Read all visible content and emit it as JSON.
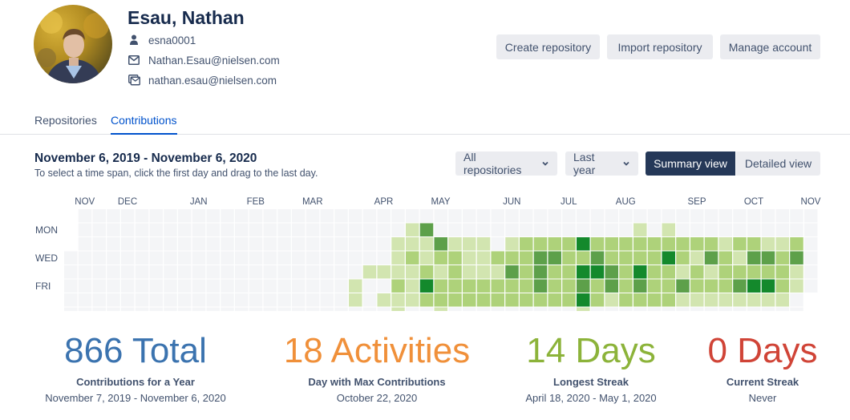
{
  "user": {
    "name": "Esau, Nathan",
    "username": "esna0001",
    "email_primary": "Nathan.Esau@nielsen.com",
    "email_secondary": "nathan.esau@nielsen.com"
  },
  "actions": {
    "create": "Create repository",
    "import": "Import repository",
    "manage": "Manage account"
  },
  "tabs": {
    "repositories": "Repositories",
    "contributions": "Contributions",
    "active": "Contributions"
  },
  "range": {
    "title": "November 6, 2019 - November 6, 2020",
    "hint": "To select a time span, click the first day and drag to the last day."
  },
  "filters": {
    "repos": "All repositories",
    "timespan": "Last year",
    "summary_view": "Summary view",
    "detailed_view": "Detailed view",
    "active_view": "Summary view"
  },
  "colors": {
    "accent": "#0052cc",
    "dark_button": "#253858",
    "total": "#3b73af",
    "activities": "#f0903a",
    "longest": "#8cb33a",
    "current": "#d04437",
    "level_0": "#f4f5f7",
    "level_1": "#d2e5b0",
    "level_2": "#aed27a",
    "level_3": "#5da04a",
    "level_4": "#14892c"
  },
  "heatmap": {
    "months": [
      "NOV",
      "DEC",
      "JAN",
      "FEB",
      "MAR",
      "APR",
      "MAY",
      "JUN",
      "JUL",
      "AUG",
      "SEP",
      "OCT",
      "NOV"
    ],
    "month_start_weeks": [
      1,
      4,
      9,
      13,
      17,
      22,
      26,
      31,
      35,
      39,
      44,
      48,
      52
    ],
    "weekday_labels": [
      {
        "row": 1,
        "label": "MON"
      },
      {
        "row": 3,
        "label": "WED"
      },
      {
        "row": 5,
        "label": "FRI"
      }
    ],
    "weeks": 53,
    "first_week_start_row": 3,
    "last_week_end_row": 5,
    "levels": [
      [
        0,
        0,
        0,
        0,
        0,
        0,
        0,
        0,
        0,
        0,
        0,
        0,
        0,
        0,
        0,
        0,
        0,
        0,
        0,
        0,
        0,
        0,
        0,
        0,
        0,
        0,
        0,
        0,
        0,
        0,
        0,
        0,
        0,
        0,
        0,
        0,
        0,
        0,
        0,
        0,
        0,
        0,
        0,
        0,
        0,
        0,
        0,
        0,
        0,
        0,
        0,
        0,
        0
      ],
      [
        0,
        0,
        0,
        0,
        0,
        0,
        0,
        0,
        0,
        0,
        0,
        0,
        0,
        0,
        0,
        0,
        0,
        0,
        0,
        0,
        0,
        0,
        0,
        0,
        1,
        3,
        0,
        0,
        0,
        0,
        0,
        0,
        0,
        0,
        0,
        0,
        0,
        0,
        0,
        0,
        1,
        0,
        1,
        0,
        0,
        0,
        0,
        0,
        0,
        0,
        0,
        0,
        0
      ],
      [
        0,
        0,
        0,
        0,
        0,
        0,
        0,
        0,
        0,
        0,
        0,
        0,
        0,
        0,
        0,
        0,
        0,
        0,
        0,
        0,
        0,
        0,
        0,
        1,
        1,
        1,
        3,
        1,
        1,
        1,
        0,
        1,
        2,
        2,
        2,
        2,
        4,
        2,
        2,
        2,
        2,
        2,
        2,
        2,
        2,
        2,
        1,
        2,
        2,
        1,
        1,
        2,
        0
      ],
      [
        0,
        0,
        0,
        0,
        0,
        0,
        0,
        0,
        0,
        0,
        0,
        0,
        0,
        0,
        0,
        0,
        0,
        0,
        0,
        0,
        0,
        0,
        0,
        1,
        2,
        1,
        2,
        2,
        1,
        1,
        2,
        2,
        2,
        3,
        3,
        2,
        2,
        3,
        2,
        2,
        2,
        2,
        4,
        2,
        1,
        3,
        2,
        1,
        3,
        3,
        2,
        3,
        0
      ],
      [
        0,
        0,
        0,
        0,
        0,
        0,
        0,
        0,
        0,
        0,
        0,
        0,
        0,
        0,
        0,
        0,
        0,
        0,
        0,
        0,
        0,
        1,
        1,
        1,
        1,
        2,
        1,
        2,
        1,
        1,
        1,
        3,
        2,
        3,
        2,
        2,
        4,
        4,
        3,
        2,
        4,
        2,
        2,
        1,
        2,
        1,
        2,
        2,
        2,
        2,
        2,
        1,
        0
      ],
      [
        0,
        0,
        0,
        0,
        0,
        0,
        0,
        0,
        0,
        0,
        0,
        0,
        0,
        0,
        0,
        0,
        0,
        0,
        0,
        0,
        1,
        0,
        0,
        2,
        1,
        4,
        2,
        2,
        2,
        2,
        2,
        2,
        2,
        3,
        2,
        2,
        3,
        2,
        3,
        2,
        3,
        2,
        2,
        3,
        2,
        2,
        2,
        3,
        4,
        4,
        2,
        1,
        0
      ],
      [
        0,
        0,
        0,
        0,
        0,
        0,
        0,
        0,
        0,
        0,
        0,
        0,
        0,
        0,
        0,
        0,
        0,
        0,
        0,
        0,
        1,
        0,
        1,
        1,
        1,
        2,
        2,
        2,
        2,
        2,
        2,
        2,
        2,
        2,
        2,
        2,
        4,
        2,
        1,
        2,
        2,
        2,
        2,
        1,
        1,
        1,
        1,
        1,
        1,
        1,
        1,
        0,
        0
      ],
      [
        0,
        0,
        0,
        0,
        0,
        0,
        0,
        0,
        0,
        0,
        0,
        0,
        0,
        0,
        0,
        0,
        0,
        0,
        0,
        0,
        0,
        0,
        0,
        1,
        0,
        0,
        1,
        0,
        0,
        0,
        0,
        0,
        0,
        0,
        0,
        0,
        1,
        0,
        0,
        0,
        0,
        0,
        0,
        0,
        0,
        0,
        0,
        0,
        0,
        0,
        0,
        0,
        0
      ]
    ]
  },
  "stats": {
    "total": {
      "value": "866 Total",
      "label": "Contributions for a Year",
      "sub": "November 7, 2019 - November 6, 2020"
    },
    "activities": {
      "value": "18 Activities",
      "label": "Day with Max Contributions",
      "sub": "October 22, 2020"
    },
    "longest": {
      "value": "14 Days",
      "label": "Longest Streak",
      "sub": "April 18, 2020 - May 1, 2020"
    },
    "current": {
      "value": "0 Days",
      "label": "Current Streak",
      "sub": "Never"
    }
  }
}
